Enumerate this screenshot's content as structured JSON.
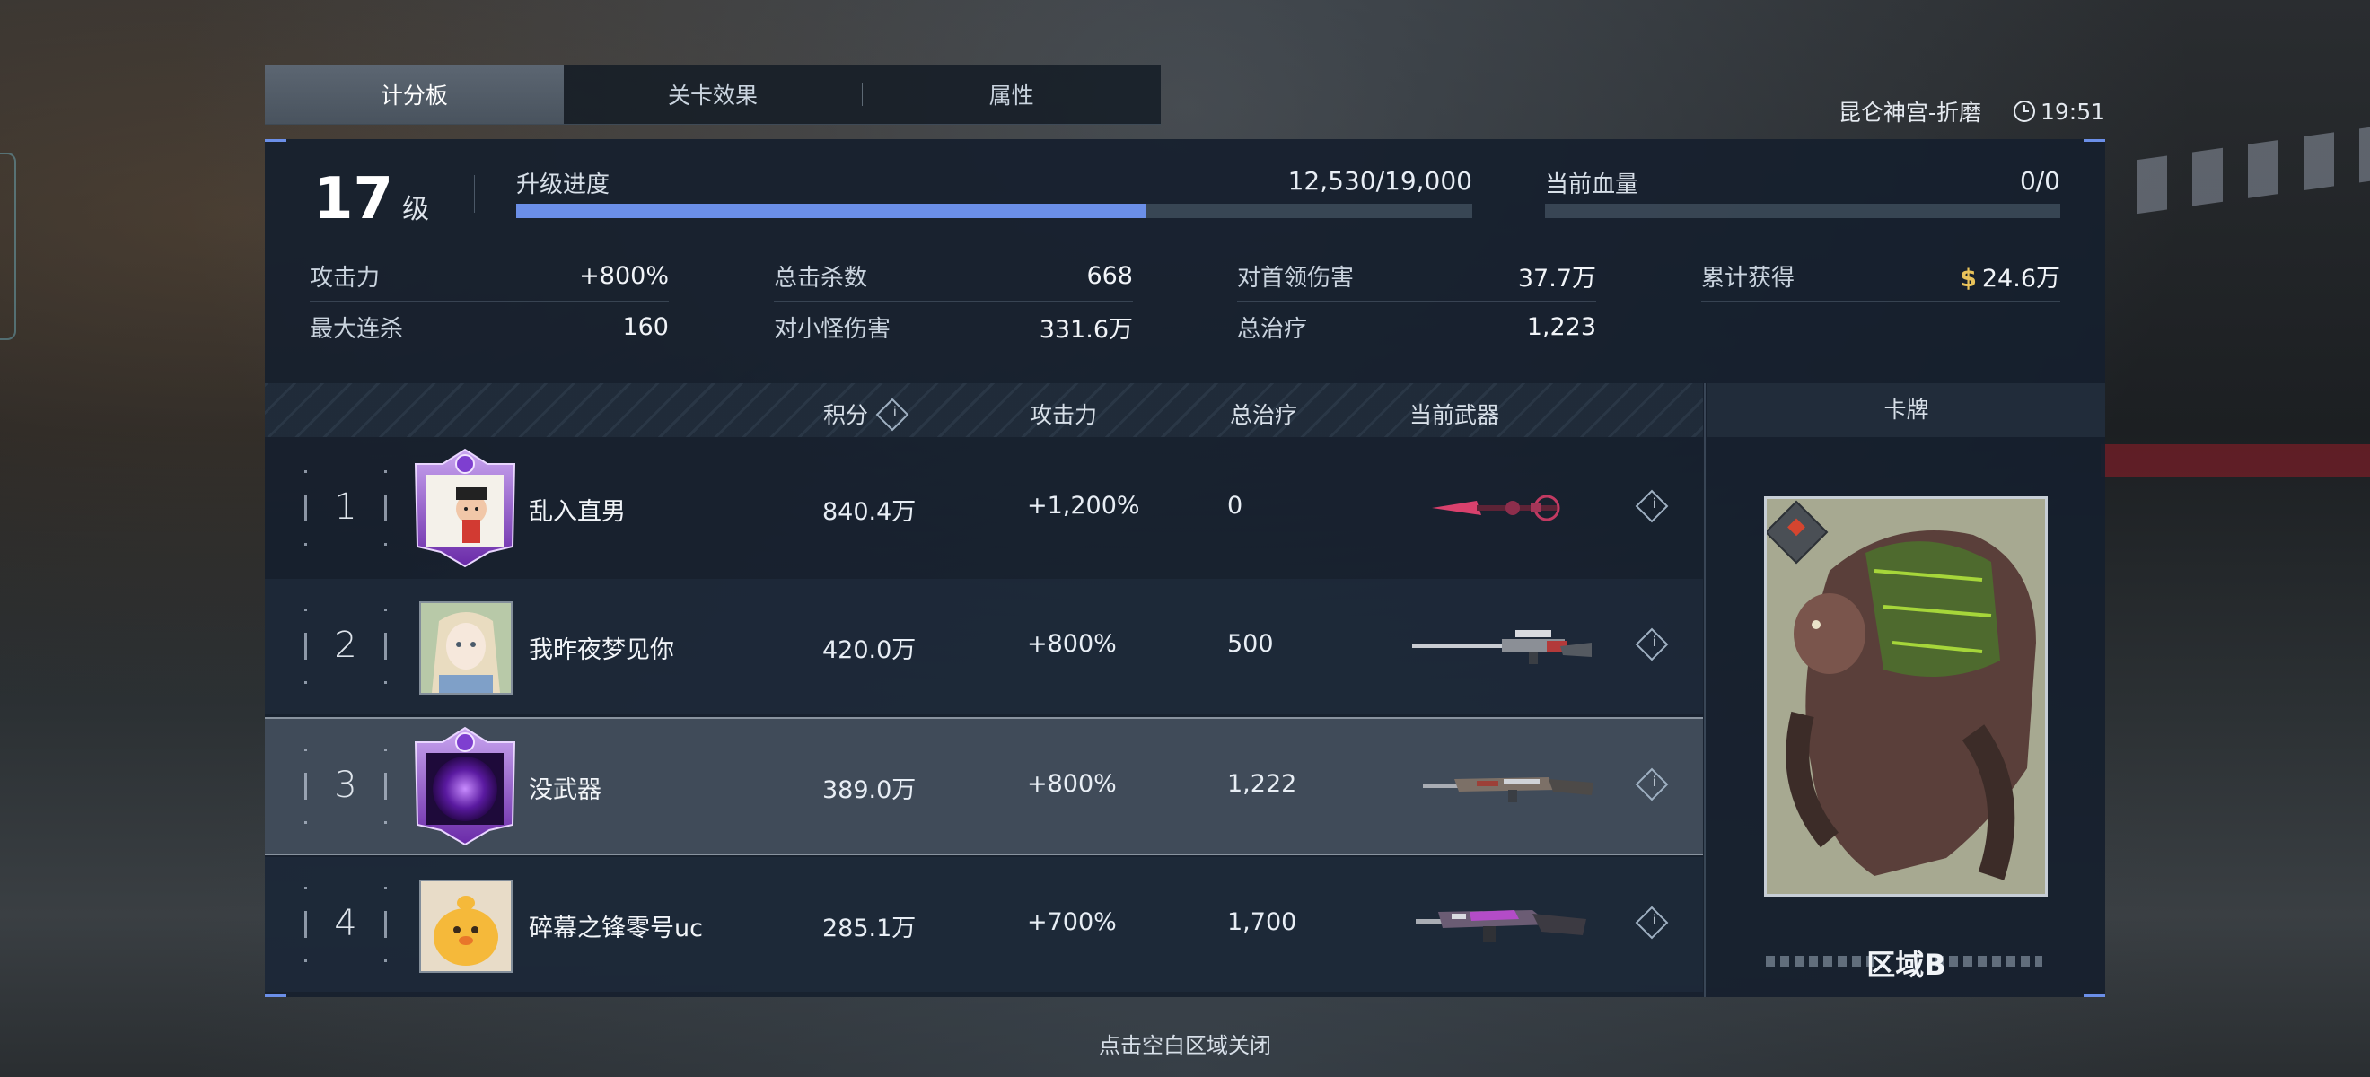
{
  "tabs": [
    {
      "label": "计分板",
      "active": true
    },
    {
      "label": "关卡效果",
      "active": false
    },
    {
      "label": "属性",
      "active": false
    }
  ],
  "header": {
    "stage": "昆仑神宫-折磨",
    "time": "19:51"
  },
  "level": {
    "value": "17",
    "unit": "级"
  },
  "progress": {
    "label": "升级进度",
    "value": "12,530/19,000",
    "fraction": 0.659
  },
  "hp": {
    "label": "当前血量",
    "value": "0/0",
    "fraction": 0
  },
  "stats": [
    [
      {
        "label": "攻击力",
        "value": "+800%"
      },
      {
        "label": "最大连杀",
        "value": "160"
      }
    ],
    [
      {
        "label": "总击杀数",
        "value": "668"
      },
      {
        "label": "对小怪伤害",
        "value": "331.6万"
      }
    ],
    [
      {
        "label": "对首领伤害",
        "value": "37.7万"
      },
      {
        "label": "总治疗",
        "value": "1,223"
      }
    ],
    [
      {
        "label": "累计获得",
        "value": "24.6万",
        "currency_icon": "$"
      }
    ]
  ],
  "table": {
    "columns": {
      "score": "积分",
      "attack": "攻击力",
      "heal": "总治疗",
      "weapon": "当前武器"
    },
    "rows": [
      {
        "rank": "1",
        "name": "乱入直男",
        "score": "840.4万",
        "attack": "+1,200%",
        "heal": "0",
        "avatar": "framed-cartoon",
        "weapon": "crimson-spear"
      },
      {
        "rank": "2",
        "name": "我昨夜梦见你",
        "score": "420.0万",
        "attack": "+800%",
        "heal": "500",
        "avatar": "anime-girl",
        "weapon": "sniper-rifle"
      },
      {
        "rank": "3",
        "name": "没武器",
        "score": "389.0万",
        "attack": "+800%",
        "heal": "1,222",
        "avatar": "framed-purple-orb",
        "weapon": "assault-rifle"
      },
      {
        "rank": "4",
        "name": "碎幕之锋零号uc",
        "score": "285.1万",
        "attack": "+700%",
        "heal": "1,700",
        "avatar": "yellow-chick",
        "weapon": "purple-rifle"
      }
    ]
  },
  "card": {
    "title": "卡牌",
    "name": "区域B"
  },
  "close_hint": "点击空白区域关闭",
  "colors": {
    "accent": "#6b8fe8",
    "money": "#e8c25a",
    "panel": "#16202e"
  }
}
